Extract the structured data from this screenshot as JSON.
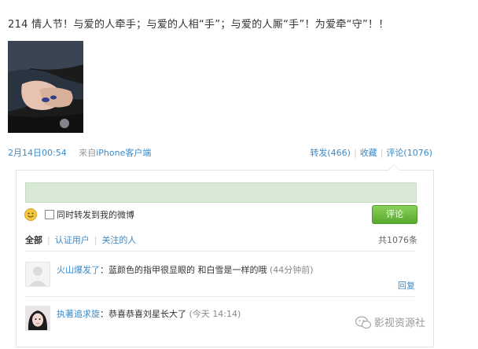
{
  "post": {
    "text": "214 情人节！与爱的人牵手；与爱的人相“手”；与爱的人厮“手”！为爱牵“守”！！",
    "time": "2月14日00:54",
    "from_prefix": "来自",
    "client": "iPhone客户端",
    "actions": {
      "forward": "转发(466)",
      "favorite": "收藏",
      "comment": "评论(1076)"
    }
  },
  "comment_panel": {
    "forward_checkbox_label": "同时转发到我的微博",
    "submit_label": "评论",
    "filters": {
      "all": "全部",
      "verified": "认证用户",
      "following": "关注的人"
    },
    "total": "共1076条"
  },
  "comments": [
    {
      "author": "火山爆发了",
      "text": "：蓝颜色的指甲很显眼的 和白雪是一样的哦",
      "time": "(44分钟前)",
      "reply": "回复"
    },
    {
      "author": "执著追求旋",
      "text": "：恭喜恭喜刘星长大了",
      "time": "(今天 14:14)"
    }
  ],
  "watermark": "影视资源社",
  "colors": {
    "link": "#3b89c7",
    "input_bg": "#d8ead5",
    "button": "#58a92c"
  }
}
